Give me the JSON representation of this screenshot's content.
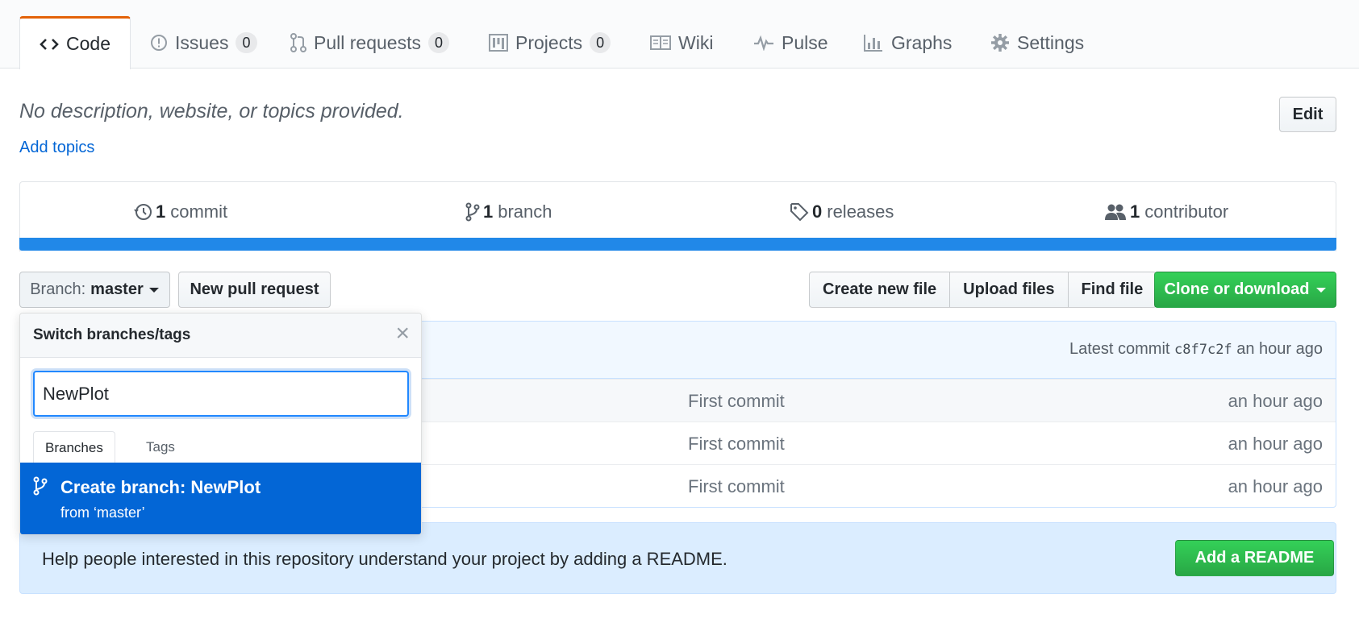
{
  "tabs": [
    {
      "label": "Code",
      "icon": "code-icon"
    },
    {
      "label": "Issues",
      "count": "0",
      "icon": "issue-icon"
    },
    {
      "label": "Pull requests",
      "count": "0",
      "icon": "pull-request-icon"
    },
    {
      "label": "Projects",
      "count": "0",
      "icon": "project-icon"
    },
    {
      "label": "Wiki",
      "icon": "book-icon"
    },
    {
      "label": "Pulse",
      "icon": "pulse-icon"
    },
    {
      "label": "Graphs",
      "icon": "graph-icon"
    },
    {
      "label": "Settings",
      "icon": "gear-icon"
    }
  ],
  "repo": {
    "description": "No description, website, or topics provided.",
    "add_topics": "Add topics",
    "edit_label": "Edit"
  },
  "summary": {
    "commits": {
      "count": "1",
      "label": "commit"
    },
    "branches": {
      "count": "1",
      "label": "branch"
    },
    "releases": {
      "count": "0",
      "label": "releases"
    },
    "contributors": {
      "count": "1",
      "label": "contributor"
    },
    "language_color": "#2188e8"
  },
  "file_nav": {
    "branch_prefix": "Branch:",
    "branch_name": "master",
    "new_pull_request": "New pull request",
    "create_new_file": "Create new file",
    "upload_files": "Upload files",
    "find_file": "Find file",
    "clone_or_download": "Clone or download"
  },
  "commit_tease": {
    "prefix": "Latest commit",
    "sha": "c8f7c2f",
    "age": "an hour ago"
  },
  "files": [
    {
      "message": "First commit",
      "age": "an hour ago"
    },
    {
      "message": "First commit",
      "age": "an hour ago"
    },
    {
      "message": "First commit",
      "age": "an hour ago"
    }
  ],
  "readme_banner": {
    "text": "Help people interested in this repository understand your project by adding a README.",
    "button": "Add a README"
  },
  "branch_dropdown": {
    "title": "Switch branches/tags",
    "filter_value": "NewPlot",
    "tab_branches": "Branches",
    "tab_tags": "Tags",
    "create_title": "Create branch: NewPlot",
    "create_from": "from ‘master’",
    "highlight_color": "#0366d6"
  },
  "colors": {
    "accent_tab": "#e36209",
    "primary_green": "#28a745",
    "link": "#0366d6"
  }
}
